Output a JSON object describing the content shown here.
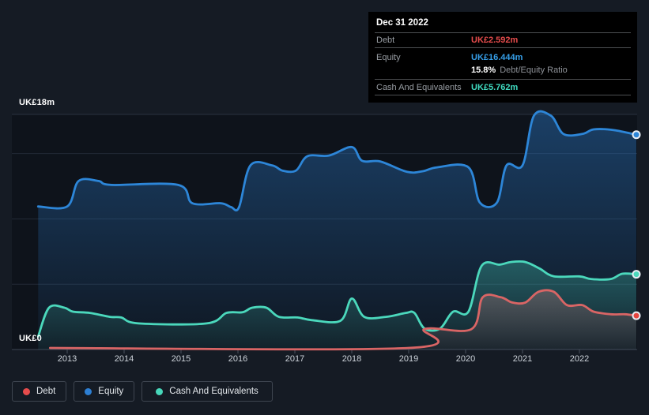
{
  "page": {
    "background": "#151b24"
  },
  "tooltip": {
    "date": "Dec 31 2022",
    "rows": {
      "debt": {
        "label": "Debt",
        "value": "UK£2.592m",
        "color": "#e64c4c"
      },
      "equity": {
        "label": "Equity",
        "value": "UK£16.444m",
        "color": "#369fe9"
      },
      "ratio": {
        "value": "15.8%",
        "label": "Debt/Equity Ratio"
      },
      "cash": {
        "label": "Cash And Equivalents",
        "value": "UK£5.762m",
        "color": "#40dcc2"
      }
    }
  },
  "legend": {
    "items": [
      {
        "label": "Debt",
        "color": "#e64c4c"
      },
      {
        "label": "Equity",
        "color": "#2d7fd3"
      },
      {
        "label": "Cash And Equivalents",
        "color": "#47d7ba"
      }
    ]
  },
  "chart_data": {
    "type": "area",
    "grid": "horizontal",
    "legend_position": "bottom-left",
    "y_axis": {
      "top_label": "UK£18m",
      "bottom_label": "UK£0",
      "min": 0,
      "max": 18,
      "unit": "UK£m",
      "gridline_values": [
        5,
        10,
        15
      ]
    },
    "x_axis": {
      "ticks": [
        "2013",
        "2014",
        "2015",
        "2016",
        "2017",
        "2018",
        "2019",
        "2020",
        "2021",
        "2022"
      ],
      "tick_years": [
        2013,
        2014,
        2015,
        2016,
        2017,
        2018,
        2019,
        2020,
        2021,
        2022
      ]
    },
    "x_range": [
      2012.49,
      2023.0
    ],
    "series": [
      {
        "name": "Debt",
        "z": 2,
        "color": "#d96565",
        "dot_color": "#e6453f",
        "fill_top": "rgba(212,124,124,0.30)",
        "fill_bottom": "rgba(212,124,124,0.05)",
        "end_value": 2.592,
        "points": [
          [
            2012.7,
            0.12
          ],
          [
            2019.0,
            0.12
          ],
          [
            2019.28,
            1.57
          ],
          [
            2020.1,
            1.55
          ],
          [
            2020.3,
            4.0
          ],
          [
            2020.62,
            4.0
          ],
          [
            2020.82,
            3.6
          ],
          [
            2021.05,
            3.6
          ],
          [
            2021.28,
            4.42
          ],
          [
            2021.55,
            4.42
          ],
          [
            2021.78,
            3.4
          ],
          [
            2022.05,
            3.4
          ],
          [
            2022.25,
            2.9
          ],
          [
            2022.55,
            2.7
          ],
          [
            2022.8,
            2.7
          ],
          [
            2023.0,
            2.592
          ]
        ]
      },
      {
        "name": "Equity",
        "z": 0,
        "color": "#2d86d8",
        "dot_color": "#2d86d8",
        "fill_top": "rgba(45,130,215,0.40)",
        "fill_bottom": "rgba(45,130,215,0.04)",
        "end_value": 16.444,
        "points": [
          [
            2012.49,
            10.95
          ],
          [
            2013.0,
            10.95
          ],
          [
            2013.2,
            12.9
          ],
          [
            2013.55,
            12.9
          ],
          [
            2013.78,
            12.6
          ],
          [
            2014.95,
            12.6
          ],
          [
            2015.2,
            11.2
          ],
          [
            2015.7,
            11.2
          ],
          [
            2015.88,
            10.9
          ],
          [
            2016.02,
            10.9
          ],
          [
            2016.22,
            14.1
          ],
          [
            2016.6,
            14.1
          ],
          [
            2016.78,
            13.7
          ],
          [
            2017.02,
            13.7
          ],
          [
            2017.22,
            14.8
          ],
          [
            2017.6,
            14.85
          ],
          [
            2018.0,
            15.5
          ],
          [
            2018.18,
            14.45
          ],
          [
            2018.5,
            14.4
          ],
          [
            2018.97,
            13.6
          ],
          [
            2019.25,
            13.65
          ],
          [
            2019.5,
            13.95
          ],
          [
            2020.05,
            13.95
          ],
          [
            2020.25,
            11.25
          ],
          [
            2020.55,
            11.25
          ],
          [
            2020.72,
            14.1
          ],
          [
            2021.0,
            14.1
          ],
          [
            2021.2,
            17.9
          ],
          [
            2021.5,
            17.9
          ],
          [
            2021.72,
            16.5
          ],
          [
            2022.05,
            16.5
          ],
          [
            2022.25,
            16.85
          ],
          [
            2022.6,
            16.8
          ],
          [
            2023.0,
            16.444
          ]
        ]
      },
      {
        "name": "Cash And Equivalents",
        "z": 1,
        "color": "#4bd8bc",
        "dot_color": "#4bd8bc",
        "fill_top": "rgba(72,216,186,0.30)",
        "fill_bottom": "rgba(72,216,186,0.05)",
        "end_value": 5.762,
        "points": [
          [
            2012.49,
            1.0
          ],
          [
            2012.68,
            3.2
          ],
          [
            2012.95,
            3.2
          ],
          [
            2013.1,
            2.9
          ],
          [
            2013.4,
            2.8
          ],
          [
            2013.75,
            2.5
          ],
          [
            2013.95,
            2.45
          ],
          [
            2014.25,
            2.0
          ],
          [
            2015.45,
            2.0
          ],
          [
            2015.8,
            2.8
          ],
          [
            2016.08,
            2.85
          ],
          [
            2016.25,
            3.2
          ],
          [
            2016.5,
            3.2
          ],
          [
            2016.72,
            2.5
          ],
          [
            2017.05,
            2.45
          ],
          [
            2017.3,
            2.25
          ],
          [
            2017.8,
            2.2
          ],
          [
            2018.0,
            3.9
          ],
          [
            2018.22,
            2.5
          ],
          [
            2018.6,
            2.5
          ],
          [
            2018.95,
            2.8
          ],
          [
            2019.1,
            2.8
          ],
          [
            2019.28,
            1.6
          ],
          [
            2019.55,
            1.6
          ],
          [
            2019.78,
            2.9
          ],
          [
            2020.05,
            2.9
          ],
          [
            2020.28,
            6.4
          ],
          [
            2020.6,
            6.5
          ],
          [
            2020.8,
            6.7
          ],
          [
            2021.05,
            6.7
          ],
          [
            2021.3,
            6.2
          ],
          [
            2021.55,
            5.6
          ],
          [
            2022.0,
            5.6
          ],
          [
            2022.2,
            5.4
          ],
          [
            2022.55,
            5.4
          ],
          [
            2022.75,
            5.8
          ],
          [
            2023.0,
            5.762
          ]
        ]
      }
    ],
    "colors": {
      "plot_background": "#0e131b",
      "gridline": "#222a36",
      "boundary_top": "#2a3340",
      "axis_bottom": "#3d4653",
      "tick": "#49525e"
    }
  }
}
